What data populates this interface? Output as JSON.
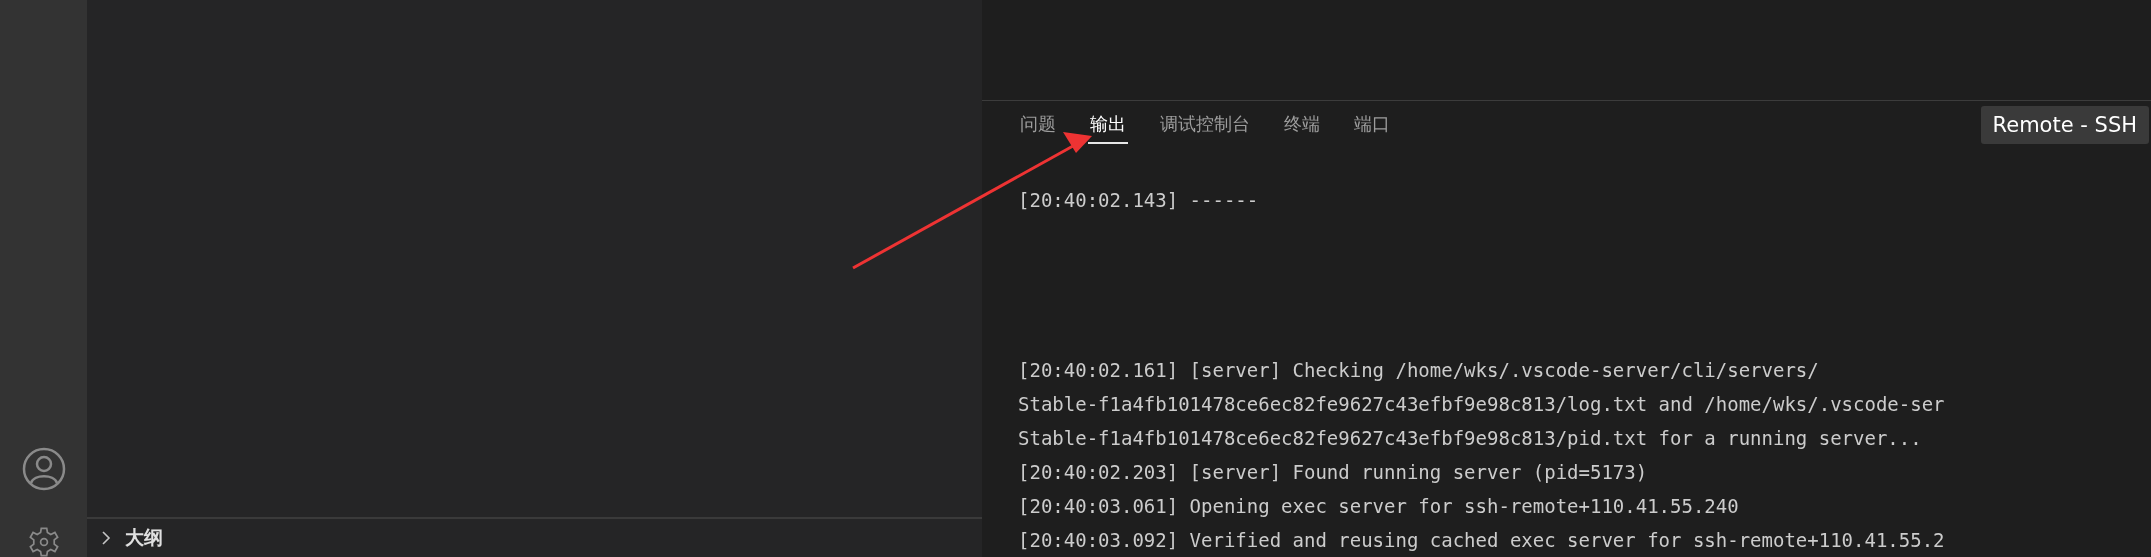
{
  "sidebar": {
    "sections": [
      {
        "label": "大纲",
        "expanded": false
      }
    ]
  },
  "panel": {
    "tabs": [
      {
        "label": "问题",
        "selected": false
      },
      {
        "label": "输出",
        "selected": true
      },
      {
        "label": "调试控制台",
        "selected": false
      },
      {
        "label": "终端",
        "selected": false
      },
      {
        "label": "端口",
        "selected": false
      }
    ],
    "channel_dropdown": {
      "value": "Remote - SSH"
    },
    "output_blocks": [
      [
        "[20:40:02.143] ------"
      ],
      [
        "[20:40:02.161] [server] Checking /home/wks/.vscode-server/cli/servers/",
        "Stable-f1a4fb101478ce6ec82fe9627c43efbf9e98c813/log.txt and /home/wks/.vscode-ser",
        "Stable-f1a4fb101478ce6ec82fe9627c43efbf9e98c813/pid.txt for a running server...",
        "[20:40:02.203] [server] Found running server (pid=5173)",
        "[20:40:03.061] Opening exec server for ssh-remote+110.41.55.240",
        "[20:40:03.092] Verified and reusing cached exec server for ssh-remote+110.41.55.2"
      ]
    ]
  }
}
